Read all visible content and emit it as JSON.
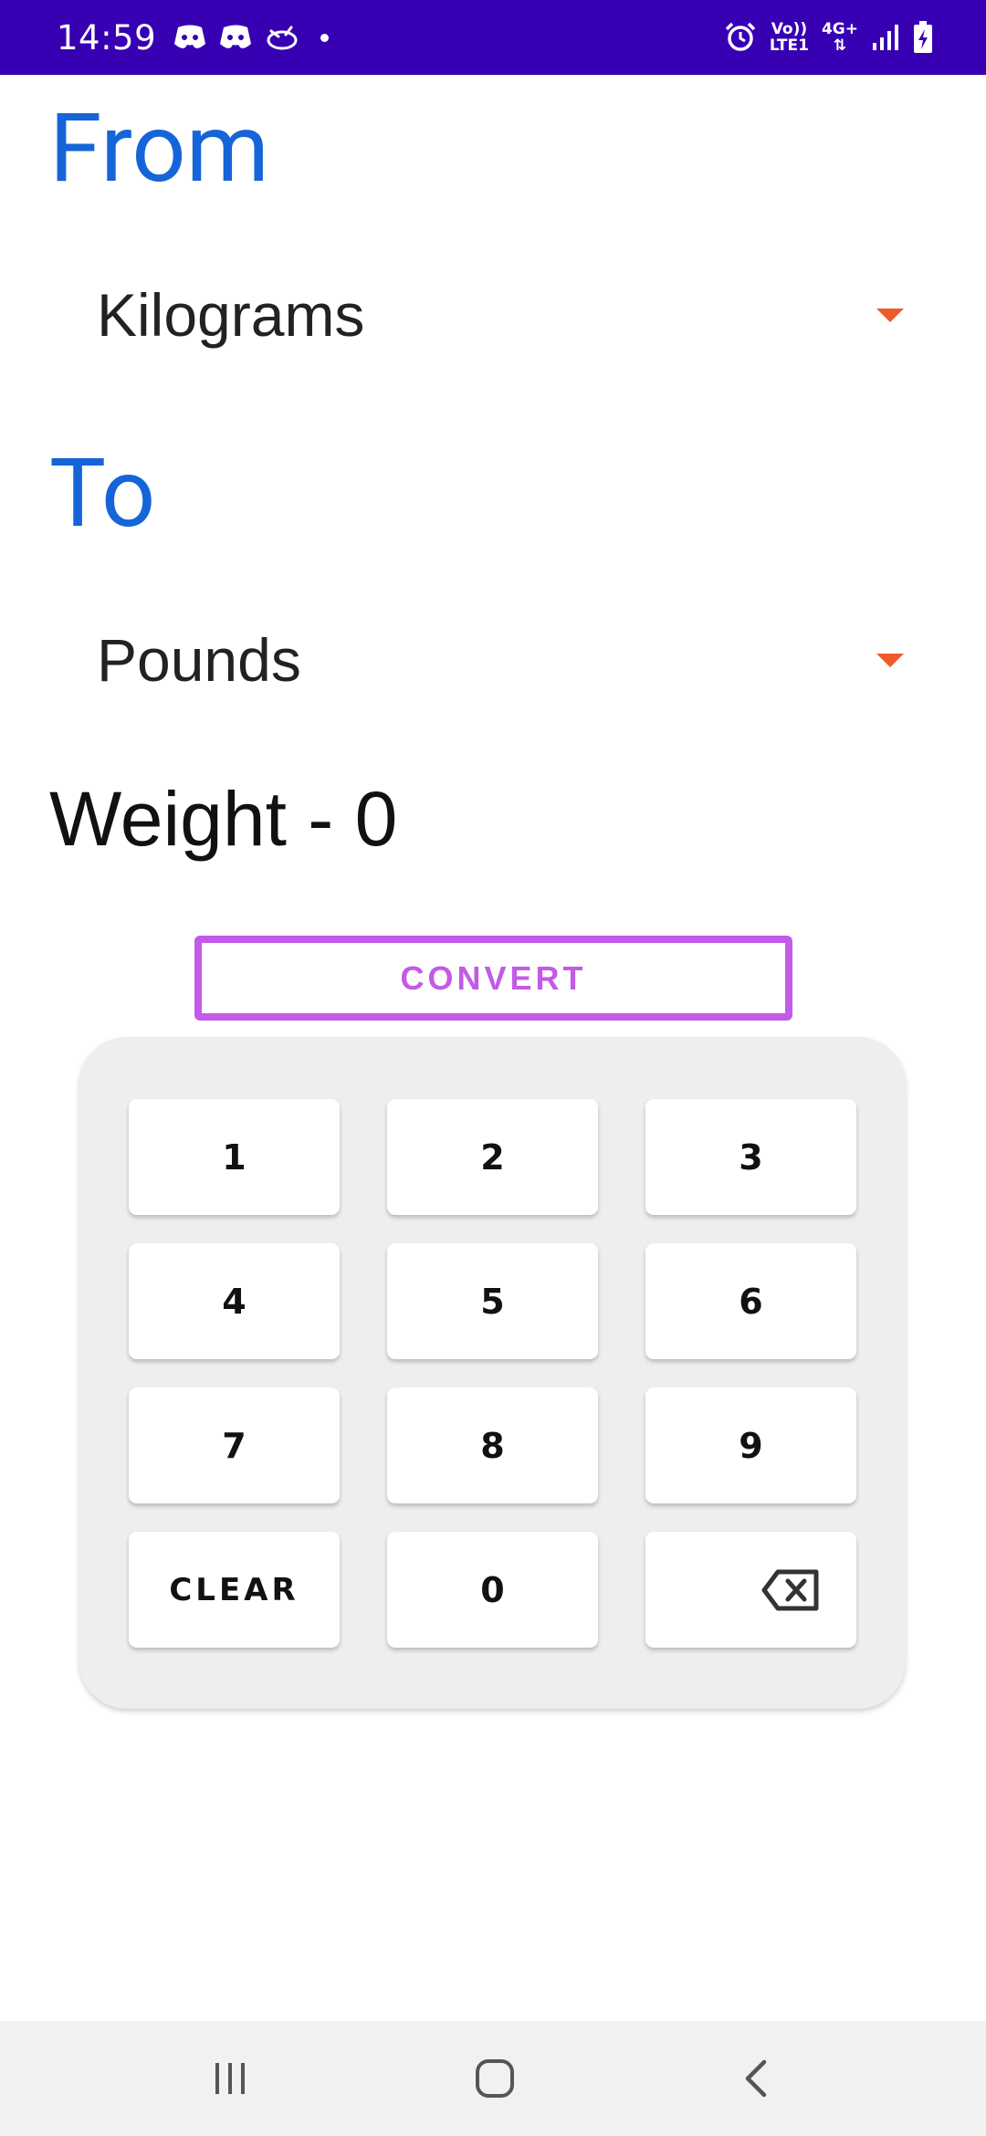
{
  "status_bar": {
    "time": "14:59",
    "network_top": "Vo))",
    "network_bottom": "LTE1",
    "data_type": "4G+",
    "icons": [
      "discord-icon",
      "discord-icon",
      "cloud-bird-icon",
      "dot-icon",
      "alarm-icon",
      "signal-icon",
      "battery-charging-icon"
    ]
  },
  "converter": {
    "from_label": "From",
    "from_value": "Kilograms",
    "to_label": "To",
    "to_value": "Pounds",
    "result_text": "Weight - 0",
    "convert_label": "CONVERT"
  },
  "keypad": {
    "keys": [
      "1",
      "2",
      "3",
      "4",
      "5",
      "6",
      "7",
      "8",
      "9",
      "CLEAR",
      "0"
    ],
    "backspace_icon": "backspace-icon"
  },
  "colors": {
    "status_bar": "#3700b3",
    "heading": "#1565d8",
    "accent_arrow": "#f0592a",
    "convert": "#c35ae8",
    "keypad_bg": "#eeeeee"
  },
  "nav_bar": {
    "icons": [
      "recent-apps-icon",
      "home-icon",
      "back-icon"
    ]
  }
}
